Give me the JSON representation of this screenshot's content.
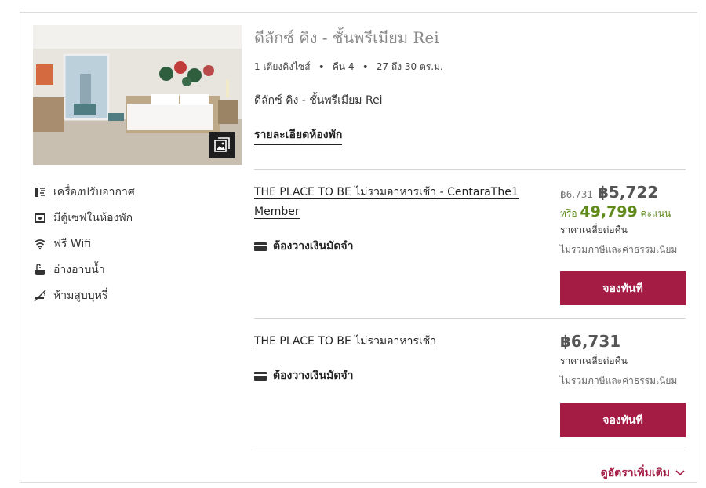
{
  "room": {
    "title": "ดีลักซ์ คิง - ชั้นพรีเมียม Rei",
    "specs": [
      "1 เตียงคิงไซส์",
      "คืน 4",
      "27 ถึง 30 ตร.ม."
    ],
    "subtitle": "ดีลักซ์ คิง - ชั้นพรีเมียม Rei",
    "details_link": "รายละเอียดห้องพัก"
  },
  "amenities": [
    {
      "icon": "air-conditioner-icon",
      "label": "เครื่องปรับอากาศ"
    },
    {
      "icon": "safe-icon",
      "label": "มีตู้เซฟในห้องพัก"
    },
    {
      "icon": "wifi-icon",
      "label": "ฟรี Wifi"
    },
    {
      "icon": "bathtub-icon",
      "label": "อ่างอาบน้ำ"
    },
    {
      "icon": "no-smoking-icon",
      "label": "ห้ามสูบบุหรี่"
    }
  ],
  "rates": [
    {
      "name": "THE PLACE TO BE ไม่รวมอาหารเช้า - CentaraThe1 Member",
      "deposit": "ต้องวางเงินมัดจำ",
      "old_price": "฿6,731",
      "price": "฿5,722",
      "points_prefix": "หรือ",
      "points": "49,799",
      "points_suffix": "คะแนน",
      "avg_label": "ราคาเฉลี่ยต่อคืน",
      "tax_label": "ไม่รวมภาษีและค่าธรรมเนียม",
      "book_label": "จองทันที"
    },
    {
      "name": "THE PLACE TO BE ไม่รวมอาหารเช้า",
      "deposit": "ต้องวางเงินมัดจำ",
      "price": "฿6,731",
      "avg_label": "ราคาเฉลี่ยต่อคืน",
      "tax_label": "ไม่รวมภาษีและค่าธรรมเนียม",
      "book_label": "จองทันที"
    }
  ],
  "more_rates_label": "ดูอัตราเพิ่มเติม",
  "colors": {
    "accent": "#a41b44",
    "points": "#5f8a1a",
    "title": "#8a8a8a"
  }
}
